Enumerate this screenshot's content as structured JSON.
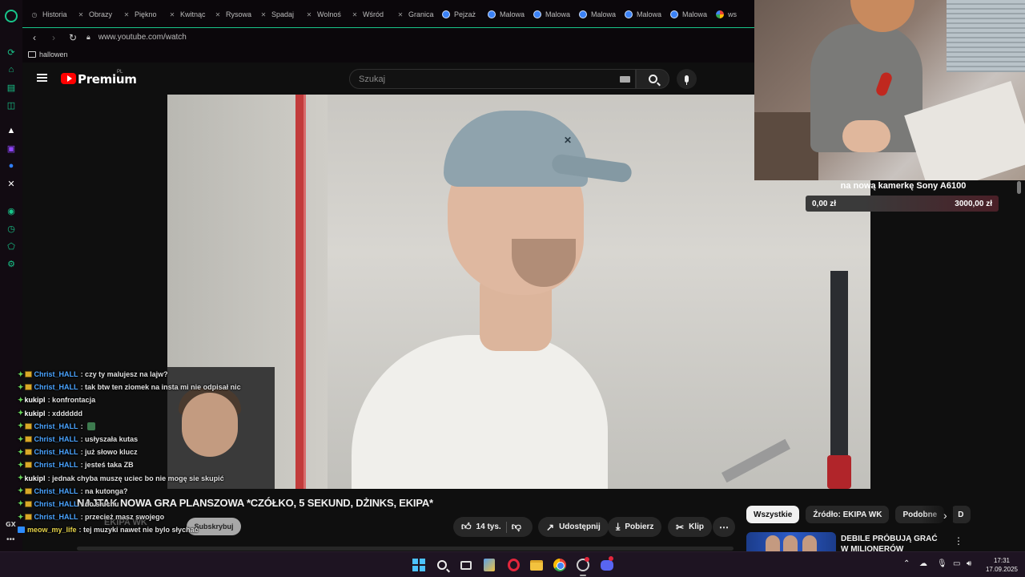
{
  "browser": {
    "tabs": [
      {
        "label": "Historia",
        "icon": "clock-icon"
      },
      {
        "label": "Obrazy",
        "icon": "tab-icon"
      },
      {
        "label": "Piękno",
        "icon": "tab-icon"
      },
      {
        "label": "Kwitnąc",
        "icon": "tab-icon"
      },
      {
        "label": "Rysowa",
        "icon": "tab-icon"
      },
      {
        "label": "Spadaj",
        "icon": "tab-icon"
      },
      {
        "label": "Wolnoś",
        "icon": "tab-icon"
      },
      {
        "label": "Wśród",
        "icon": "tab-icon"
      },
      {
        "label": "Granica",
        "icon": "tab-icon"
      },
      {
        "label": "Pejzaż",
        "icon": "globe-icon"
      },
      {
        "label": "Malowa",
        "icon": "globe-icon"
      },
      {
        "label": "Malowa",
        "icon": "globe-icon"
      },
      {
        "label": "Malowa",
        "icon": "globe-icon"
      },
      {
        "label": "Malowa",
        "icon": "globe-icon"
      },
      {
        "label": "Malowa",
        "icon": "globe-icon"
      },
      {
        "label": "ws",
        "icon": "google-icon"
      }
    ],
    "url": "www.youtube.com/watch",
    "bookmark_folder": "hallowen",
    "sidebar_label": "GX"
  },
  "youtube": {
    "logo_text": "Premium",
    "country": "PL",
    "search_placeholder": "Szukaj",
    "video_title": "NAJTAK NOWA GRA PLANSZOWA *CZÓŁKO, 5 SEKUND, DŻINKS, EKIPA*",
    "channel_name": "EKIPA WK",
    "subscribe_label": "Subskrybuj",
    "likes": "14 tys.",
    "share_label": "Udostępnij",
    "download_label": "Pobierz",
    "clip_label": "Klip",
    "chips": [
      "Wszystkie",
      "Źródło: EKIPA WK",
      "Podobne",
      "D"
    ],
    "recommendation_title": "DEBILE PRÓBUJĄ GRAĆ W MILIONERÓW"
  },
  "stream_goal": {
    "title": "na nową kamerkę Sony A6100",
    "current": "0,00 zł",
    "target": "3000,00 zł",
    "progress_fraction": 0.0
  },
  "chat": [
    {
      "user": "Christ_HALL",
      "color": "blue",
      "badges": [
        "green",
        "yellow"
      ],
      "message": ": czy ty malujesz na lajw?"
    },
    {
      "user": "Christ_HALL",
      "color": "blue",
      "badges": [
        "green",
        "yellow"
      ],
      "message": ": tak btw ten ziomek na insta mi nie odpisał nic"
    },
    {
      "user": "kukipl",
      "color": "white",
      "badges": [
        "green"
      ],
      "message": ": konfrontacja"
    },
    {
      "user": "kukipl",
      "color": "white",
      "badges": [
        "green"
      ],
      "message": ": xdddddd"
    },
    {
      "user": "Christ_HALL",
      "color": "blue",
      "badges": [
        "green",
        "yellow"
      ],
      "message": ":",
      "emote": true
    },
    {
      "user": "Christ_HALL",
      "color": "blue",
      "badges": [
        "green",
        "yellow"
      ],
      "message": ": usłyszała kutas"
    },
    {
      "user": "Christ_HALL",
      "color": "blue",
      "badges": [
        "green",
        "yellow"
      ],
      "message": ": już słowo klucz"
    },
    {
      "user": "Christ_HALL",
      "color": "blue",
      "badges": [
        "green",
        "yellow"
      ],
      "message": ": jesteś taka ZB"
    },
    {
      "user": "kukipl",
      "color": "white",
      "badges": [
        "green"
      ],
      "message": ": jednak chyba muszę uciec bo nie mogę sie skupić"
    },
    {
      "user": "Christ_HALL",
      "color": "blue",
      "badges": [
        "green",
        "yellow"
      ],
      "message": ": na kutonga?"
    },
    {
      "user": "Christ_HALL",
      "color": "blue",
      "badges": [
        "green",
        "yellow"
      ],
      "message": ": do słuchu"
    },
    {
      "user": "Christ_HALL",
      "color": "blue",
      "badges": [
        "green",
        "yellow"
      ],
      "message": ": przecież masz swojego"
    },
    {
      "user": "meow_my_life",
      "color": "yellow",
      "badges": [
        "blue"
      ],
      "message": ": tej muzyki nawet nie bylo słychać"
    }
  ],
  "taskbar": {
    "time": "17:31",
    "date": "17.09.2025"
  }
}
